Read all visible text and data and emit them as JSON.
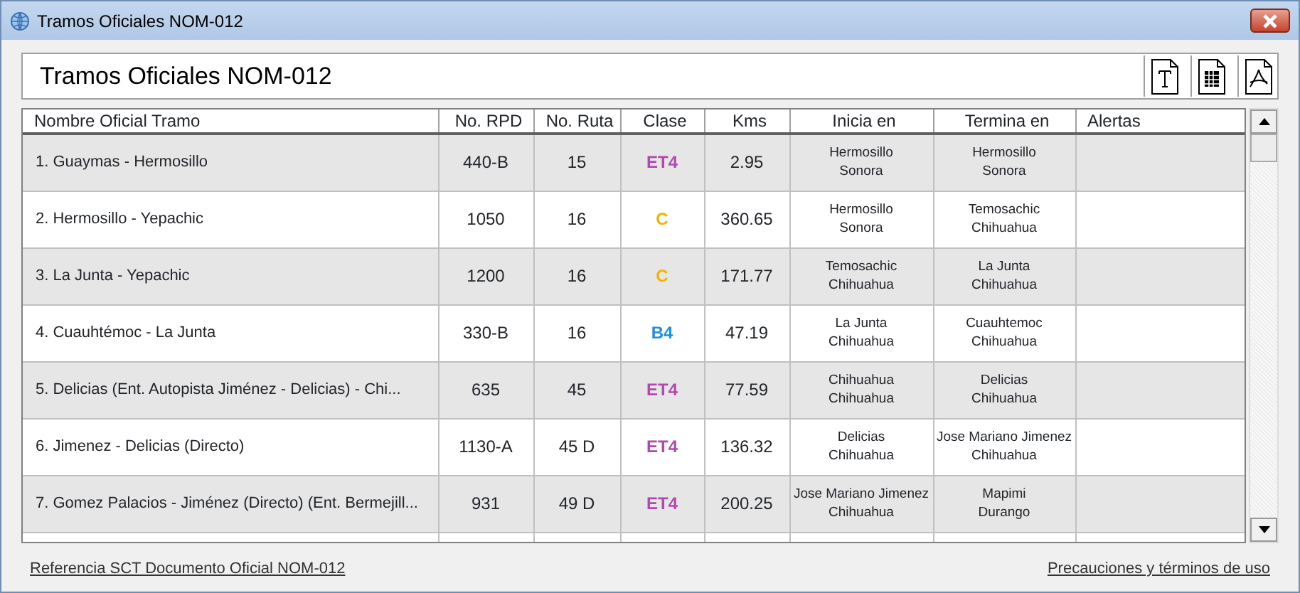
{
  "window": {
    "title": "Tramos Oficiales NOM-012"
  },
  "header": {
    "title": "Tramos Oficiales NOM-012"
  },
  "table": {
    "columns": [
      "Nombre Oficial Tramo",
      "No. RPD",
      "No. Ruta",
      "Clase",
      "Kms",
      "Inicia en",
      "Termina en",
      "Alertas"
    ],
    "rows": [
      {
        "name": "1.  Guaymas - Hermosillo",
        "rpd": "440-B",
        "ruta": "15",
        "clase": "ET4",
        "color": "#b04ab0",
        "kms": "2.95",
        "inicia": [
          "Hermosillo",
          "Sonora"
        ],
        "termina": [
          "Hermosillo",
          "Sonora"
        ]
      },
      {
        "name": "2.  Hermosillo - Yepachic",
        "rpd": "1050",
        "ruta": "16",
        "clase": "C",
        "color": "#f0b400",
        "kms": "360.65",
        "inicia": [
          "Hermosillo",
          "Sonora"
        ],
        "termina": [
          "Temosachic",
          "Chihuahua"
        ]
      },
      {
        "name": "3.  La Junta - Yepachic",
        "rpd": "1200",
        "ruta": "16",
        "clase": "C",
        "color": "#f0b400",
        "kms": "171.77",
        "inicia": [
          "Temosachic",
          "Chihuahua"
        ],
        "termina": [
          "La Junta",
          "Chihuahua"
        ]
      },
      {
        "name": "4.  Cuauhtémoc - La Junta",
        "rpd": "330-B",
        "ruta": "16",
        "clase": "B4",
        "color": "#1c8fe0",
        "kms": "47.19",
        "inicia": [
          "La Junta",
          "Chihuahua"
        ],
        "termina": [
          "Cuauhtemoc",
          "Chihuahua"
        ]
      },
      {
        "name": "5.  Delicias (Ent. Autopista Jiménez - Delicias) - Chi...",
        "rpd": "635",
        "ruta": "45",
        "clase": "ET4",
        "color": "#b04ab0",
        "kms": "77.59",
        "inicia": [
          "Chihuahua",
          "Chihuahua"
        ],
        "termina": [
          "Delicias",
          "Chihuahua"
        ]
      },
      {
        "name": "6.  Jimenez - Delicias (Directo)",
        "rpd": "1130-A",
        "ruta": "45 D",
        "clase": "ET4",
        "color": "#b04ab0",
        "kms": "136.32",
        "inicia": [
          "Delicias",
          "Chihuahua"
        ],
        "termina": [
          "Jose Mariano Jimenez",
          "Chihuahua"
        ]
      },
      {
        "name": "7.  Gomez Palacios - Jiménez (Directo) (Ent. Bermejill...",
        "rpd": "931",
        "ruta": "49 D",
        "clase": "ET4",
        "color": "#b04ab0",
        "kms": "200.25",
        "inicia": [
          "Jose Mariano Jimenez",
          "Chihuahua"
        ],
        "termina": [
          "Mapimi",
          "Durango"
        ]
      }
    ]
  },
  "footer": {
    "left_link": "Referencia SCT Documento Oficial NOM-012",
    "right_link": "Precauciones y términos de uso"
  }
}
